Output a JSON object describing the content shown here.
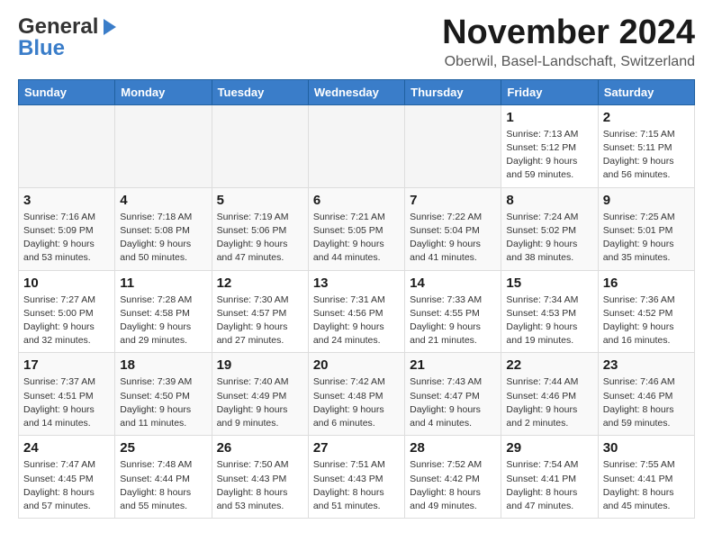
{
  "header": {
    "logo_general": "General",
    "logo_blue": "Blue",
    "month_title": "November 2024",
    "subtitle": "Oberwil, Basel-Landschaft, Switzerland"
  },
  "weekdays": [
    "Sunday",
    "Monday",
    "Tuesday",
    "Wednesday",
    "Thursday",
    "Friday",
    "Saturday"
  ],
  "rows": [
    [
      {
        "day": "",
        "info": ""
      },
      {
        "day": "",
        "info": ""
      },
      {
        "day": "",
        "info": ""
      },
      {
        "day": "",
        "info": ""
      },
      {
        "day": "",
        "info": ""
      },
      {
        "day": "1",
        "info": "Sunrise: 7:13 AM\nSunset: 5:12 PM\nDaylight: 9 hours and 59 minutes."
      },
      {
        "day": "2",
        "info": "Sunrise: 7:15 AM\nSunset: 5:11 PM\nDaylight: 9 hours and 56 minutes."
      }
    ],
    [
      {
        "day": "3",
        "info": "Sunrise: 7:16 AM\nSunset: 5:09 PM\nDaylight: 9 hours and 53 minutes."
      },
      {
        "day": "4",
        "info": "Sunrise: 7:18 AM\nSunset: 5:08 PM\nDaylight: 9 hours and 50 minutes."
      },
      {
        "day": "5",
        "info": "Sunrise: 7:19 AM\nSunset: 5:06 PM\nDaylight: 9 hours and 47 minutes."
      },
      {
        "day": "6",
        "info": "Sunrise: 7:21 AM\nSunset: 5:05 PM\nDaylight: 9 hours and 44 minutes."
      },
      {
        "day": "7",
        "info": "Sunrise: 7:22 AM\nSunset: 5:04 PM\nDaylight: 9 hours and 41 minutes."
      },
      {
        "day": "8",
        "info": "Sunrise: 7:24 AM\nSunset: 5:02 PM\nDaylight: 9 hours and 38 minutes."
      },
      {
        "day": "9",
        "info": "Sunrise: 7:25 AM\nSunset: 5:01 PM\nDaylight: 9 hours and 35 minutes."
      }
    ],
    [
      {
        "day": "10",
        "info": "Sunrise: 7:27 AM\nSunset: 5:00 PM\nDaylight: 9 hours and 32 minutes."
      },
      {
        "day": "11",
        "info": "Sunrise: 7:28 AM\nSunset: 4:58 PM\nDaylight: 9 hours and 29 minutes."
      },
      {
        "day": "12",
        "info": "Sunrise: 7:30 AM\nSunset: 4:57 PM\nDaylight: 9 hours and 27 minutes."
      },
      {
        "day": "13",
        "info": "Sunrise: 7:31 AM\nSunset: 4:56 PM\nDaylight: 9 hours and 24 minutes."
      },
      {
        "day": "14",
        "info": "Sunrise: 7:33 AM\nSunset: 4:55 PM\nDaylight: 9 hours and 21 minutes."
      },
      {
        "day": "15",
        "info": "Sunrise: 7:34 AM\nSunset: 4:53 PM\nDaylight: 9 hours and 19 minutes."
      },
      {
        "day": "16",
        "info": "Sunrise: 7:36 AM\nSunset: 4:52 PM\nDaylight: 9 hours and 16 minutes."
      }
    ],
    [
      {
        "day": "17",
        "info": "Sunrise: 7:37 AM\nSunset: 4:51 PM\nDaylight: 9 hours and 14 minutes."
      },
      {
        "day": "18",
        "info": "Sunrise: 7:39 AM\nSunset: 4:50 PM\nDaylight: 9 hours and 11 minutes."
      },
      {
        "day": "19",
        "info": "Sunrise: 7:40 AM\nSunset: 4:49 PM\nDaylight: 9 hours and 9 minutes."
      },
      {
        "day": "20",
        "info": "Sunrise: 7:42 AM\nSunset: 4:48 PM\nDaylight: 9 hours and 6 minutes."
      },
      {
        "day": "21",
        "info": "Sunrise: 7:43 AM\nSunset: 4:47 PM\nDaylight: 9 hours and 4 minutes."
      },
      {
        "day": "22",
        "info": "Sunrise: 7:44 AM\nSunset: 4:46 PM\nDaylight: 9 hours and 2 minutes."
      },
      {
        "day": "23",
        "info": "Sunrise: 7:46 AM\nSunset: 4:46 PM\nDaylight: 8 hours and 59 minutes."
      }
    ],
    [
      {
        "day": "24",
        "info": "Sunrise: 7:47 AM\nSunset: 4:45 PM\nDaylight: 8 hours and 57 minutes."
      },
      {
        "day": "25",
        "info": "Sunrise: 7:48 AM\nSunset: 4:44 PM\nDaylight: 8 hours and 55 minutes."
      },
      {
        "day": "26",
        "info": "Sunrise: 7:50 AM\nSunset: 4:43 PM\nDaylight: 8 hours and 53 minutes."
      },
      {
        "day": "27",
        "info": "Sunrise: 7:51 AM\nSunset: 4:43 PM\nDaylight: 8 hours and 51 minutes."
      },
      {
        "day": "28",
        "info": "Sunrise: 7:52 AM\nSunset: 4:42 PM\nDaylight: 8 hours and 49 minutes."
      },
      {
        "day": "29",
        "info": "Sunrise: 7:54 AM\nSunset: 4:41 PM\nDaylight: 8 hours and 47 minutes."
      },
      {
        "day": "30",
        "info": "Sunrise: 7:55 AM\nSunset: 4:41 PM\nDaylight: 8 hours and 45 minutes."
      }
    ]
  ]
}
